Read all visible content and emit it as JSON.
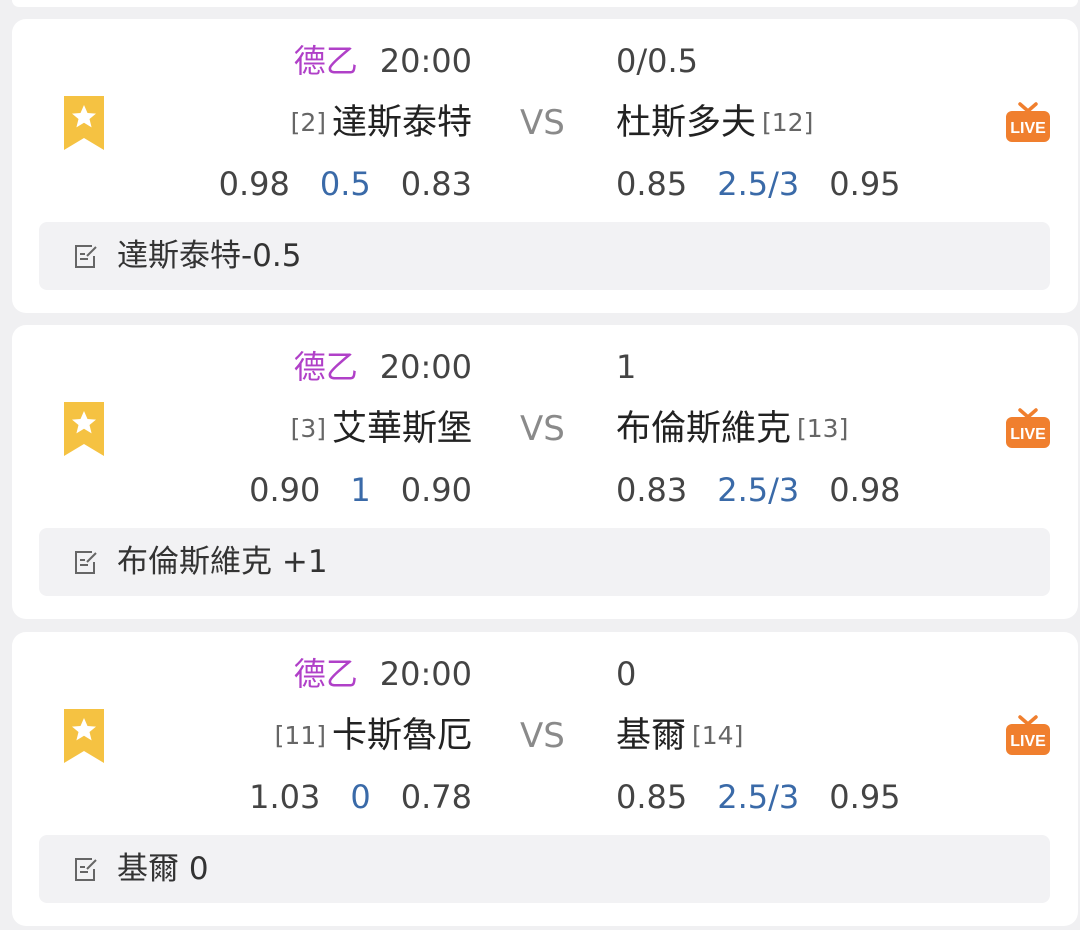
{
  "matches": [
    {
      "league": "德乙",
      "time": "20:00",
      "handicap": "0/0.5",
      "home_rank": "[2]",
      "home_team": "達斯泰特",
      "vs": "VS",
      "away_team": "杜斯多夫",
      "away_rank": "[12]",
      "home_odds_1": "0.98",
      "home_line": "0.5",
      "home_odds_2": "0.83",
      "ou_odds_1": "0.85",
      "ou_line": "2.5/3",
      "ou_odds_2": "0.95",
      "tip": "達斯泰特-0.5"
    },
    {
      "league": "德乙",
      "time": "20:00",
      "handicap": "1",
      "home_rank": "[3]",
      "home_team": "艾華斯堡",
      "vs": "VS",
      "away_team": "布倫斯維克",
      "away_rank": "[13]",
      "home_odds_1": "0.90",
      "home_line": "1",
      "home_odds_2": "0.90",
      "ou_odds_1": "0.83",
      "ou_line": "2.5/3",
      "ou_odds_2": "0.98",
      "tip": "布倫斯維克 +1"
    },
    {
      "league": "德乙",
      "time": "20:00",
      "handicap": "0",
      "home_rank": "[11]",
      "home_team": "卡斯魯厄",
      "vs": "VS",
      "away_team": "基爾",
      "away_rank": "[14]",
      "home_odds_1": "1.03",
      "home_line": "0",
      "home_odds_2": "0.78",
      "ou_odds_1": "0.85",
      "ou_line": "2.5/3",
      "ou_odds_2": "0.95",
      "tip": "基爾 0"
    }
  ],
  "live_badge": "LIVE",
  "icons": {
    "favorite": "bookmark-star-icon",
    "live": "live-tv-icon",
    "tip": "note-edit-icon"
  },
  "colors": {
    "league": "#b040c8",
    "line": "#3a6aa8",
    "fav": "#f5c242",
    "live": "#f07f2e"
  }
}
